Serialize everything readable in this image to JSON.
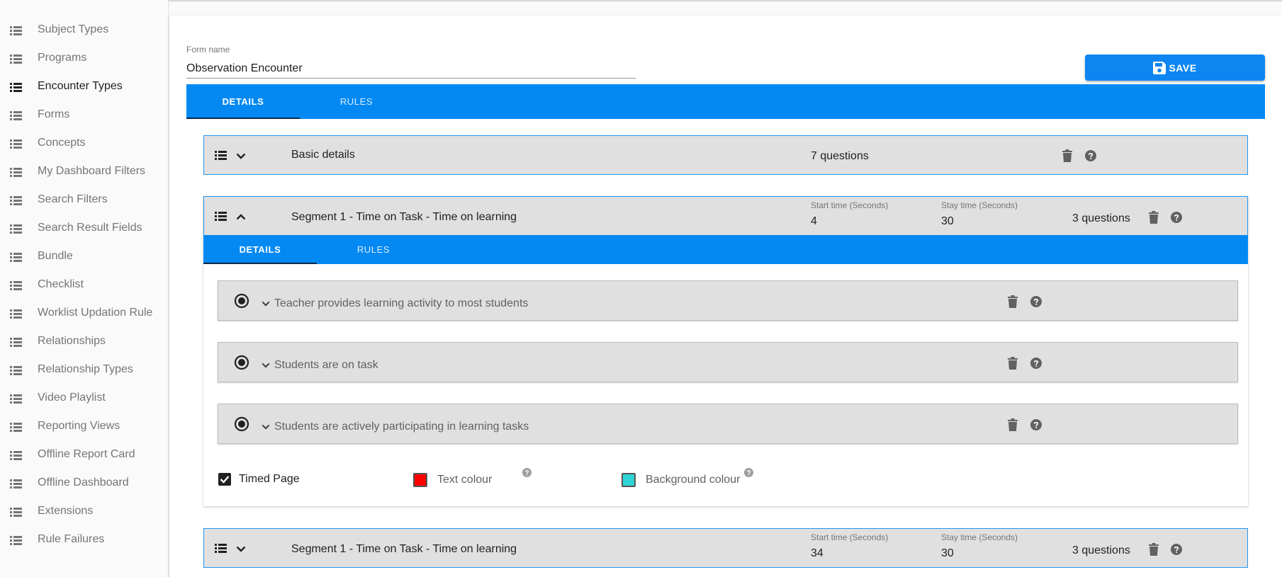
{
  "sidebar": {
    "items": [
      {
        "label": "Subject Types",
        "active": false
      },
      {
        "label": "Programs",
        "active": false
      },
      {
        "label": "Encounter Types",
        "active": true
      },
      {
        "label": "Forms",
        "active": false
      },
      {
        "label": "Concepts",
        "active": false
      },
      {
        "label": "My Dashboard Filters",
        "active": false
      },
      {
        "label": "Search Filters",
        "active": false
      },
      {
        "label": "Search Result Fields",
        "active": false
      },
      {
        "label": "Bundle",
        "active": false
      },
      {
        "label": "Checklist",
        "active": false
      },
      {
        "label": "Worklist Updation Rule",
        "active": false
      },
      {
        "label": "Relationships",
        "active": false
      },
      {
        "label": "Relationship Types",
        "active": false
      },
      {
        "label": "Video Playlist",
        "active": false
      },
      {
        "label": "Reporting Views",
        "active": false
      },
      {
        "label": "Offline Report Card",
        "active": false
      },
      {
        "label": "Offline Dashboard",
        "active": false
      },
      {
        "label": "Extensions",
        "active": false
      },
      {
        "label": "Rule Failures",
        "active": false
      }
    ]
  },
  "form": {
    "name_label": "Form name",
    "name_value": "Observation Encounter",
    "save_label": "SAVE"
  },
  "tabs": {
    "details": "DETAILS",
    "rules": "RULES"
  },
  "groups": {
    "basic": {
      "title": "Basic details",
      "question_count": "7 questions"
    },
    "segment1": {
      "title": "Segment 1 - Time on Task -  Time on learning",
      "start_label": "Start time (Seconds)",
      "start_value": "4",
      "stay_label": "Stay time (Seconds)",
      "stay_value": "30",
      "question_count": "3 questions",
      "tabs": {
        "details": "DETAILS",
        "rules": "RULES"
      },
      "questions": [
        {
          "label": "Teacher provides learning activity to most students"
        },
        {
          "label": "Students are on task"
        },
        {
          "label": "Students are actively participating in learning tasks"
        }
      ],
      "timed_page_label": "Timed Page",
      "timed_page_checked": true,
      "text_colour_label": "Text colour",
      "text_colour": "#ff0000",
      "background_colour_label": "Background colour",
      "background_colour": "#2ed3d3"
    },
    "segment2": {
      "title": "Segment 1 - Time on Task -  Time on learning",
      "start_label": "Start time (Seconds)",
      "start_value": "34",
      "stay_label": "Stay time (Seconds)",
      "stay_value": "30",
      "question_count": "3 questions"
    }
  },
  "colors": {
    "accent": "#0489f3",
    "group_bg": "#e0e0e0",
    "group_border": "#2196f3"
  }
}
